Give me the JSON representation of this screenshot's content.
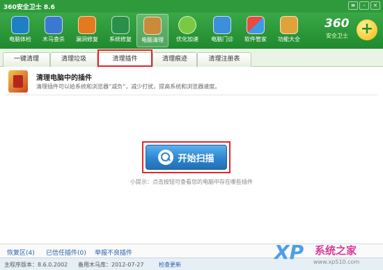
{
  "window": {
    "title": "360安全卫士 8.6"
  },
  "toolbar": {
    "items": [
      {
        "label": "电脑体检",
        "icon": "monitor-checkup-icon"
      },
      {
        "label": "木马查杀",
        "icon": "shield-icon"
      },
      {
        "label": "漏洞修复",
        "icon": "patch-icon"
      },
      {
        "label": "系统修复",
        "icon": "wrench-icon"
      },
      {
        "label": "电脑清理",
        "icon": "broom-icon",
        "active": true
      },
      {
        "label": "优化加速",
        "icon": "rocket-icon"
      },
      {
        "label": "电脑门诊",
        "icon": "clinic-icon"
      },
      {
        "label": "软件管家",
        "icon": "software-grid-icon"
      },
      {
        "label": "功能大全",
        "icon": "toolbox-icon"
      }
    ]
  },
  "brand": {
    "name": "360",
    "tagline": "安全卫士"
  },
  "tabs": [
    {
      "label": "一键清理"
    },
    {
      "label": "清理垃圾"
    },
    {
      "label": "清理插件",
      "active": true
    },
    {
      "label": "清理痕迹"
    },
    {
      "label": "清理注册表"
    }
  ],
  "header": {
    "title": "清理电脑中的插件",
    "description": "清理插件可以给系统和浏览器“减负”，减少打扰，提高系统和浏览器速度。"
  },
  "main": {
    "scan_button_label": "开始扫描",
    "tip": "小提示：点击按钮可查看您的电脑中存在哪些插件"
  },
  "bottom_links": {
    "restore": "恢复区(4)",
    "trusted": "已信任插件(0)",
    "report": "举报不良插件"
  },
  "status": {
    "main_version": "主程序版本：8.6.0.2002",
    "trojan_db": "备用木马库：2012-07-27",
    "check_update": "检查更新"
  },
  "watermark": {
    "xp": "XP",
    "site": "系统之家",
    "url": "www.xp510.com"
  },
  "colors": {
    "brand_green": "#2f9a3c",
    "highlight_red": "#e0262b",
    "scan_blue": "#2d86cf",
    "link_blue": "#2a5fa8"
  }
}
